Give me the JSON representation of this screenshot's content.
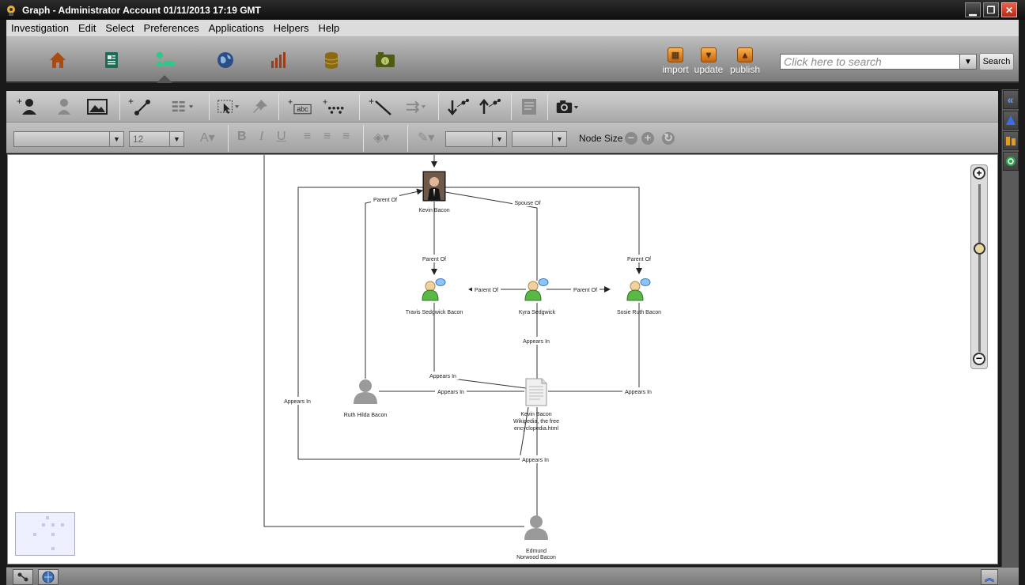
{
  "window": {
    "title": "Graph - Administrator Account 01/11/2013 17:19 GMT"
  },
  "menu": {
    "items": [
      "Investigation",
      "Edit",
      "Select",
      "Preferences",
      "Applications",
      "Helpers",
      "Help"
    ]
  },
  "mainbar": {
    "nav_icons": [
      "home-icon",
      "document-icon",
      "graph-icon",
      "globe-icon",
      "bar-chart-icon",
      "database-icon",
      "camera-info-icon"
    ],
    "active": "graph-icon",
    "publish_actions": [
      {
        "label": "import",
        "icon": "import-icon"
      },
      {
        "label": "update",
        "icon": "update-icon"
      },
      {
        "label": "publish",
        "icon": "publish-icon"
      }
    ]
  },
  "search": {
    "placeholder": "Click here to search",
    "button_label": "Search"
  },
  "format_toolbar": {
    "font_family": "",
    "font_size": "12",
    "node_size_label": "Node Size"
  },
  "graph": {
    "nodes": [
      {
        "id": "kevin",
        "label": "Kevin Bacon",
        "type": "photo"
      },
      {
        "id": "travis",
        "label": "Travis Sedgwick Bacon",
        "type": "person-comment"
      },
      {
        "id": "kyra",
        "label": "Kyra Sedgwick",
        "type": "person-comment"
      },
      {
        "id": "sosie",
        "label": "Sosie Ruth Bacon",
        "type": "person-comment"
      },
      {
        "id": "ruth",
        "label": "Ruth Hilda Bacon",
        "type": "silhouette"
      },
      {
        "id": "doc",
        "label_lines": [
          "Kevin Bacon",
          "Wikipedia, the free",
          "encyclopedia.html"
        ],
        "type": "document"
      },
      {
        "id": "edmund",
        "label_lines": [
          "Edmund",
          "Norwood Bacon"
        ],
        "type": "silhouette"
      }
    ],
    "edges": [
      {
        "label": "Parent Of"
      },
      {
        "label": "Spouse Of"
      },
      {
        "label": "Parent Of"
      },
      {
        "label": "Parent Of"
      },
      {
        "label": "Parent Of"
      },
      {
        "label": "Parent Of"
      },
      {
        "label": "Parent Of"
      },
      {
        "label": "Appears In"
      },
      {
        "label": "Appears In"
      },
      {
        "label": "Appears In"
      },
      {
        "label": "Appears In"
      },
      {
        "label": "Appears In"
      },
      {
        "label": "Appears In"
      }
    ]
  },
  "colors": {
    "accent_orange": "#e2891c",
    "nav_green": "#2ec889",
    "close_red": "#c83a24"
  }
}
